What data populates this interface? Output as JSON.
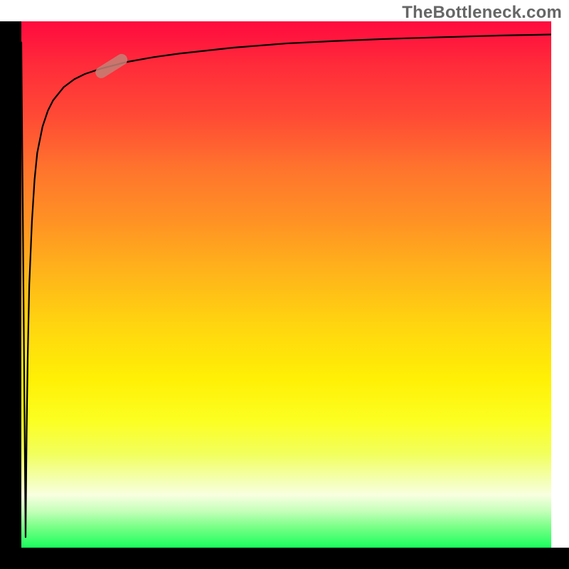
{
  "watermark": "TheBottleneck.com",
  "colors": {
    "gradient_top": "#ff0a3f",
    "gradient_mid": "#ffd60f",
    "gradient_bottom": "#1aff5e",
    "curve": "#000000",
    "marker": "#c38177",
    "borders": "#000000"
  },
  "chart_data": {
    "type": "line",
    "title": "",
    "xlabel": "",
    "ylabel": "",
    "xlim": [
      0,
      100
    ],
    "ylim": [
      0,
      100
    ],
    "legend": false,
    "grid": false,
    "series": [
      {
        "name": "curve",
        "x": [
          0.0,
          0.8,
          1.0,
          1.2,
          1.5,
          2.0,
          2.5,
          3.0,
          4.0,
          5.0,
          6.0,
          8.0,
          10.0,
          12.0,
          15.0,
          20.0,
          25.0,
          30.0,
          40.0,
          50.0,
          60.0,
          70.0,
          80.0,
          90.0,
          100.0
        ],
        "y": [
          96.0,
          2.0,
          22.0,
          36.0,
          50.0,
          62.0,
          70.0,
          75.0,
          80.0,
          83.0,
          85.0,
          87.5,
          89.0,
          90.0,
          91.0,
          92.3,
          93.2,
          93.9,
          95.0,
          95.8,
          96.3,
          96.7,
          97.0,
          97.3,
          97.5
        ]
      }
    ],
    "annotations": [
      {
        "name": "highlight-marker",
        "x": 17,
        "y": 91.5
      }
    ]
  }
}
